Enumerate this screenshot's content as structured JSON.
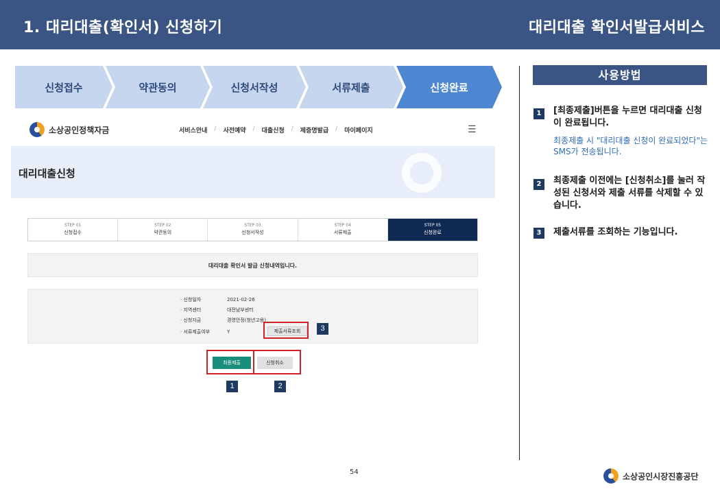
{
  "header": {
    "title": "1. 대리대출(확인서) 신청하기",
    "service": "대리대출 확인서발급서비스"
  },
  "process_steps": [
    "신청접수",
    "약관동의",
    "신청서작성",
    "서류제출",
    "신청완료"
  ],
  "site": {
    "logo_text": "소상공인정책자금",
    "nav": [
      "서비스안내",
      "사전예약",
      "대출신청",
      "제증명발급",
      "마이페이지"
    ],
    "page_title": "대리대출신청"
  },
  "steps": [
    {
      "num": "STEP 01",
      "label": "신청접수"
    },
    {
      "num": "STEP 02",
      "label": "약관동의"
    },
    {
      "num": "STEP 03",
      "label": "신청서작성"
    },
    {
      "num": "STEP 04",
      "label": "서류제출"
    },
    {
      "num": "STEP 05",
      "label": "신청완료"
    }
  ],
  "notice": "대리대출 확인서 발급 신청내역입니다.",
  "details": [
    {
      "key": "· 신청일자",
      "value": "2021-02-26"
    },
    {
      "key": "· 지역센터",
      "value": "대전남부센터"
    },
    {
      "key": "· 신청자금",
      "value": "경영안정(청년고용)"
    },
    {
      "key": "· 서류제출여부",
      "value": "Y"
    }
  ],
  "buttons": {
    "doc_view": "제출서류조회",
    "final_submit": "최종제출",
    "cancel": "신청취소"
  },
  "markers": [
    "1",
    "2",
    "3"
  ],
  "guide": {
    "title": "사용방법",
    "items": [
      {
        "num": "1",
        "text": "[최종제출]버튼을 누르면 대리대출 신청이 완료됩니다.",
        "sub": "최종제출 시 \"대리대출 신청이 완료되었다\"는 SMS가 전송됩니다."
      },
      {
        "num": "2",
        "text": "최종제출 이전에는 [신청취소]를 눌러 작성된 신청서와 제출 서류를 삭제할 수 있습니다."
      },
      {
        "num": "3",
        "text": "제출서류를 조회하는 기능입니다."
      }
    ]
  },
  "footer": {
    "page": "54",
    "org": "소상공인시장진흥공단"
  },
  "colors": {
    "header_bg": "#3a5583",
    "step_light": "#c6d6ee",
    "step_active": "#4f86d2",
    "final_button": "#1b8e7b",
    "highlight": "#d0202a",
    "marker": "#1e3a60",
    "sub_text": "#2f6cb5"
  }
}
